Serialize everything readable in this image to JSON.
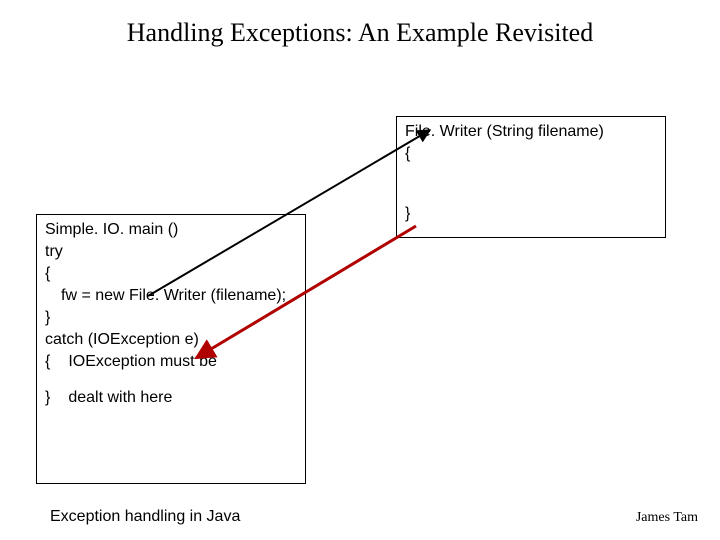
{
  "title": "Handling Exceptions: An Example Revisited",
  "rbox": {
    "header": "File. Writer (String filename)",
    "open": "{",
    "close": "}"
  },
  "lbox": {
    "header": "Simple. IO. main ()",
    "try": "try",
    "open1": "{",
    "fw": "fw = new File. Writer (filename);",
    "close1": "}",
    "catch": "catch (IOException e)",
    "open2": "{",
    "note1": "IOException must be",
    "close2": "}",
    "note2": "dealt with here"
  },
  "footer_left": "Exception handling in Java",
  "footer_right": "James Tam"
}
